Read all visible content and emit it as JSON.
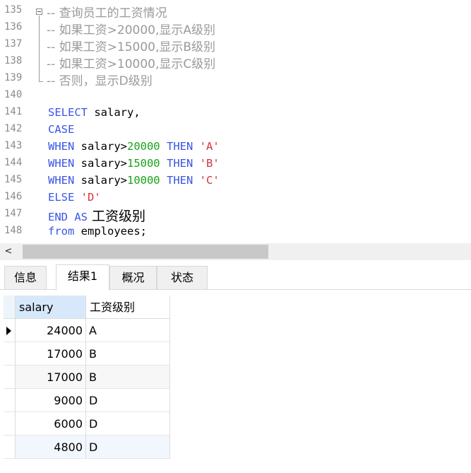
{
  "editor": {
    "lines": [
      {
        "no": "135",
        "comment": "-- 查询员工的工资情况"
      },
      {
        "no": "136",
        "comment": "-- 如果工资>20000,显示A级别"
      },
      {
        "no": "137",
        "comment": "-- 如果工资>15000,显示B级别"
      },
      {
        "no": "138",
        "comment": "-- 如果工资>10000,显示C级别"
      },
      {
        "no": "139",
        "comment": "-- 否则，显示D级别"
      },
      {
        "no": "140"
      },
      {
        "no": "141",
        "kw1": "SELECT",
        "rest": " salary,"
      },
      {
        "no": "142",
        "kw1": "CASE"
      },
      {
        "no": "143",
        "kw1": "WHEN",
        "col": " salary>",
        "num": "20000",
        "kw2": " THEN ",
        "str": "'A'"
      },
      {
        "no": "144",
        "kw1": "WHEN",
        "col": " salary>",
        "num": "15000",
        "kw2": " THEN ",
        "str": "'B'"
      },
      {
        "no": "145",
        "kw1": "WHEN",
        "col": " salary>",
        "num": "10000",
        "kw2": " THEN ",
        "str": "'C'"
      },
      {
        "no": "146",
        "kw1": "ELSE",
        "str": " 'D'"
      },
      {
        "no": "147",
        "kw1": "END AS",
        "alias": " 工资级别"
      },
      {
        "no": "148",
        "kw1": "from",
        "rest": " employees;"
      }
    ]
  },
  "scrollbar": {
    "left_arrow": "<"
  },
  "tabs": [
    "信息",
    "结果1",
    "概况",
    "状态"
  ],
  "active_tab": "结果1",
  "results": {
    "columns": [
      "salary",
      "工资级别"
    ],
    "rows": [
      [
        "24000",
        "A"
      ],
      [
        "17000",
        "B"
      ],
      [
        "17000",
        "B"
      ],
      [
        "9000",
        "D"
      ],
      [
        "6000",
        "D"
      ],
      [
        "4800",
        "D"
      ]
    ]
  },
  "icons": {
    "row_pointer": "triangle-right-icon",
    "fold": "minus-box-icon"
  },
  "colors": {
    "keyword": "#3a54e8",
    "number": "#19a319",
    "string": "#d7323a",
    "comment": "#9a9a9a",
    "selected_header": "#d7e8fa"
  }
}
